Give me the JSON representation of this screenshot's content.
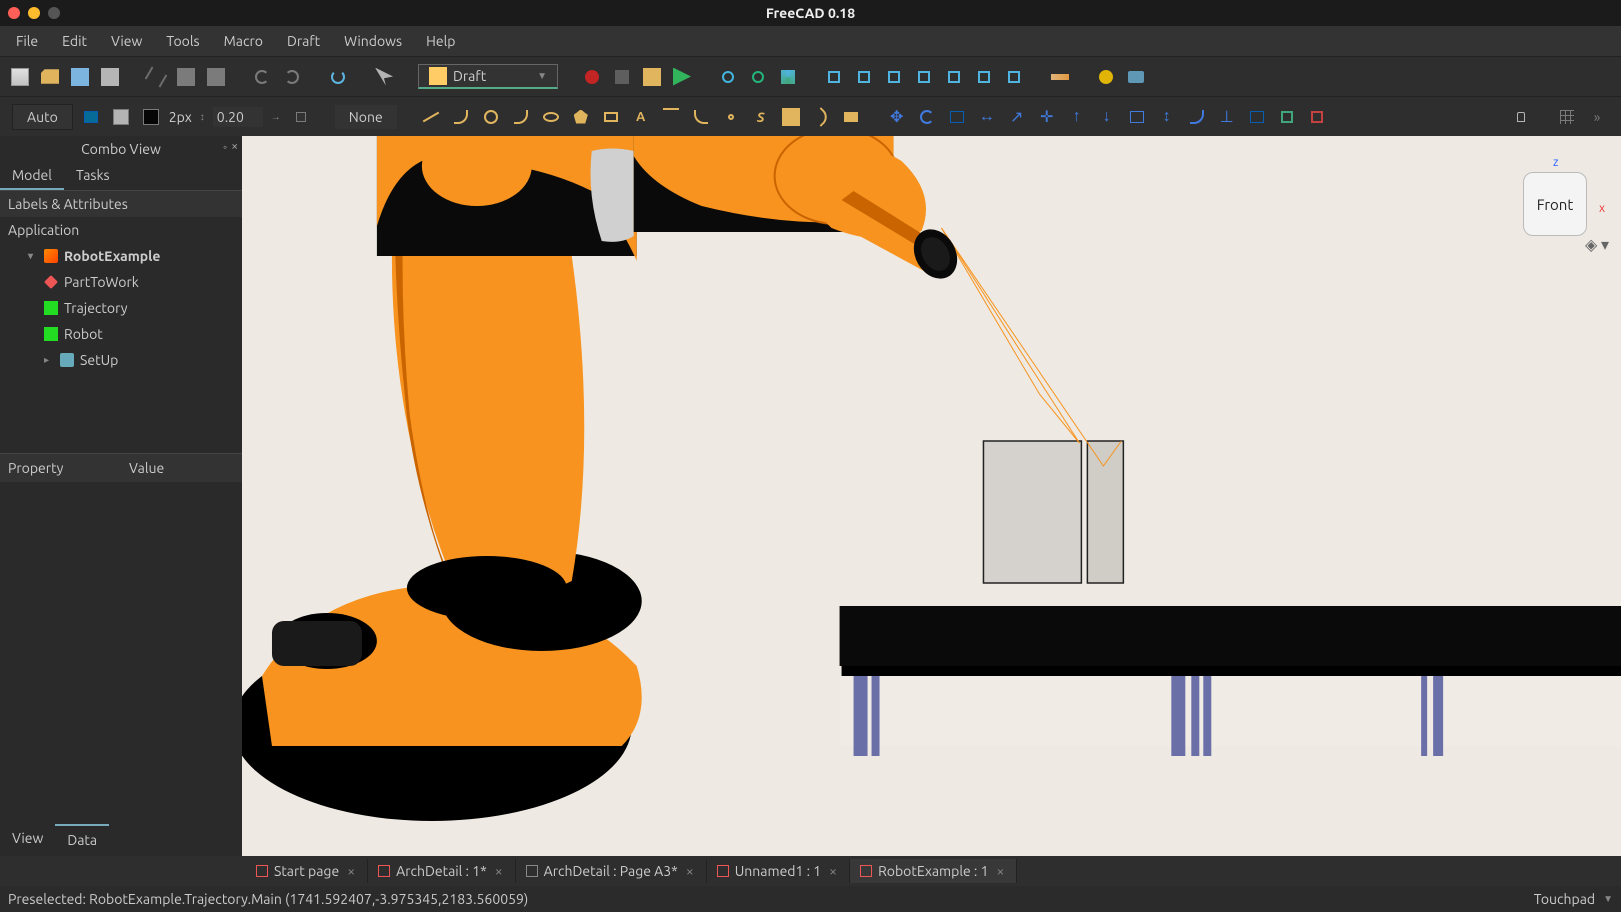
{
  "title": "FreeCAD 0.18",
  "menu": [
    "File",
    "Edit",
    "View",
    "Tools",
    "Macro",
    "Draft",
    "Windows",
    "Help"
  ],
  "workbench": "Draft",
  "toolbar2": {
    "auto": "Auto",
    "px": "2px",
    "spin": "0.20",
    "none": "None"
  },
  "combo": {
    "header": "Combo View",
    "tabs": [
      "Model",
      "Tasks"
    ],
    "active_tab": 0,
    "section": "Labels & Attributes",
    "tree": {
      "root": "Application",
      "doc": "RobotExample",
      "items": [
        "PartToWork",
        "Trajectory",
        "Robot",
        "SetUp"
      ]
    },
    "prop_cols": [
      "Property",
      "Value"
    ],
    "bottom_tabs": [
      "View",
      "Data"
    ],
    "bottom_active": 1
  },
  "navcube": {
    "face": "Front"
  },
  "doctabs": [
    {
      "label": "Start page",
      "closable": true
    },
    {
      "label": "ArchDetail : 1*",
      "closable": true
    },
    {
      "label": "ArchDetail : Page A3*",
      "closable": true
    },
    {
      "label": "Unnamed1 : 1",
      "closable": true
    },
    {
      "label": "RobotExample : 1",
      "closable": true
    }
  ],
  "status": {
    "left": "Preselected: RobotExample.Trajectory.Main (1741.592407,-3.975345,2183.560059)",
    "right": "Touchpad"
  }
}
